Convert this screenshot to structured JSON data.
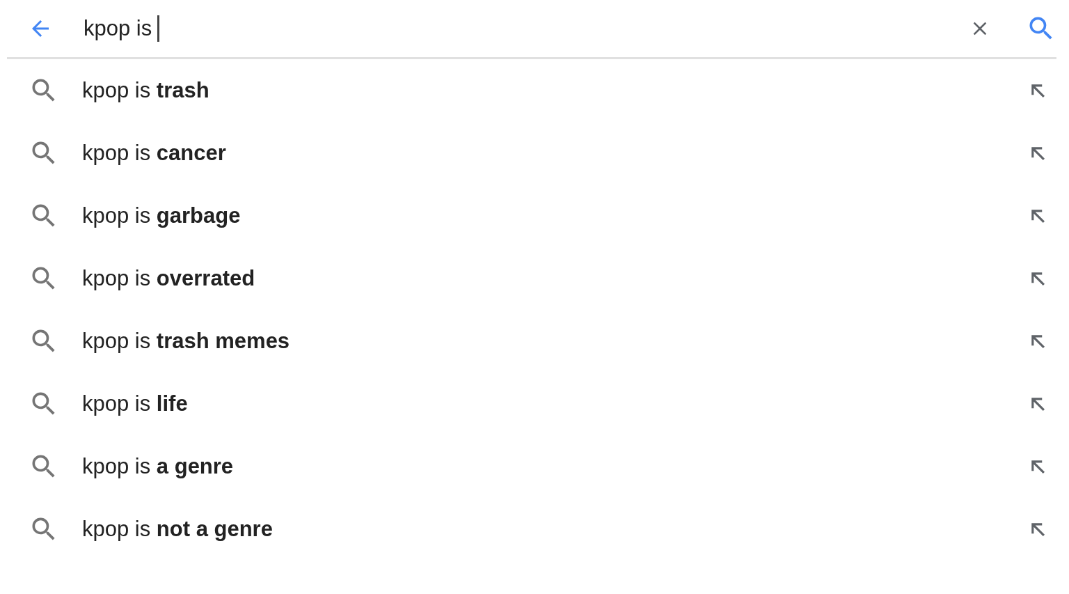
{
  "search_bar": {
    "query": "kpop is"
  },
  "suggestions": [
    {
      "text": "kpop is **trash**"
    },
    {
      "text": "kpop is **cancer**"
    },
    {
      "text": "kpop is **garbage**"
    },
    {
      "text": "kpop is **overrated**"
    },
    {
      "text": "kpop is **trash memes**"
    },
    {
      "text": "kpop is **life**"
    },
    {
      "text": "kpop is **a genre**"
    },
    {
      "text": "kpop is **not a genre**"
    }
  ]
}
